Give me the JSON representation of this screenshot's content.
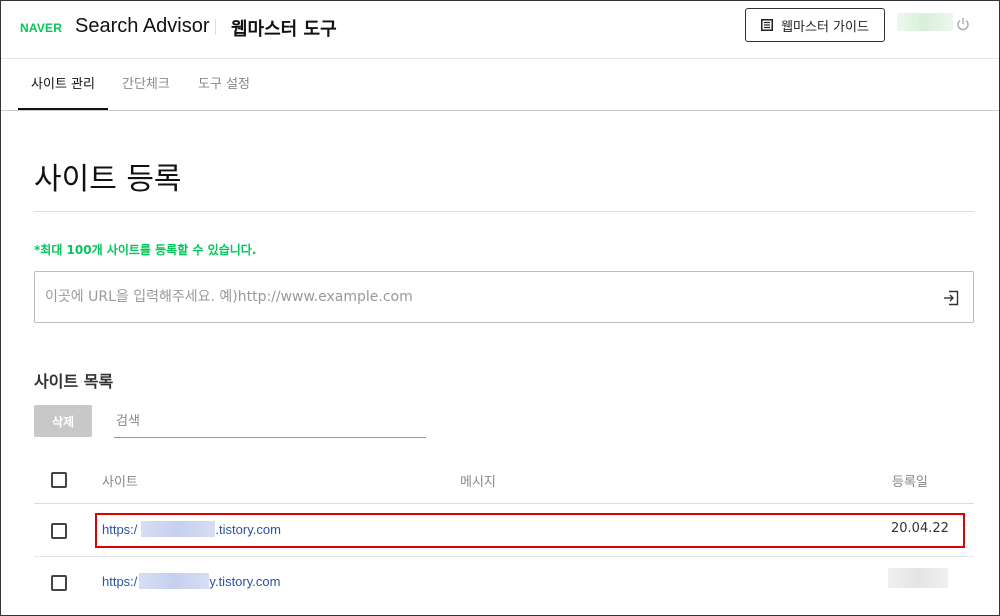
{
  "header": {
    "logo": "NAVER",
    "brand": "Search Advisor",
    "tool_title": "웹마스터 도구",
    "guide_button": "웹마스터 가이드",
    "guide_icon": "book-icon",
    "power_icon": "power-icon"
  },
  "tabs": [
    {
      "label": "사이트 관리",
      "active": true
    },
    {
      "label": "간단체크",
      "active": false
    },
    {
      "label": "도구 설정",
      "active": false
    }
  ],
  "main": {
    "title": "사이트 등록",
    "notice": "*최대 100개 사이트를 등록할 수 있습니다.",
    "url_placeholder": "이곳에 URL을 입력해주세요. 예)http://www.example.com",
    "url_value": "",
    "enter_icon": "enter-icon"
  },
  "site_list": {
    "heading": "사이트 목록",
    "delete_label": "삭제",
    "search_placeholder": "검색",
    "columns": {
      "site": "사이트",
      "message": "메시지",
      "date": "등록일"
    },
    "rows": [
      {
        "url_prefix": "https:/",
        "url_suffix": ".tistory.com",
        "message": "",
        "date": "20.04.22",
        "highlighted": true
      },
      {
        "url_prefix": "https:/",
        "url_suffix": "y.tistory.com",
        "message": "",
        "date": "",
        "highlighted": false
      }
    ]
  },
  "colors": {
    "brand_green": "#03c75a",
    "link_blue": "#2953a5",
    "highlight_red": "#e00000"
  }
}
